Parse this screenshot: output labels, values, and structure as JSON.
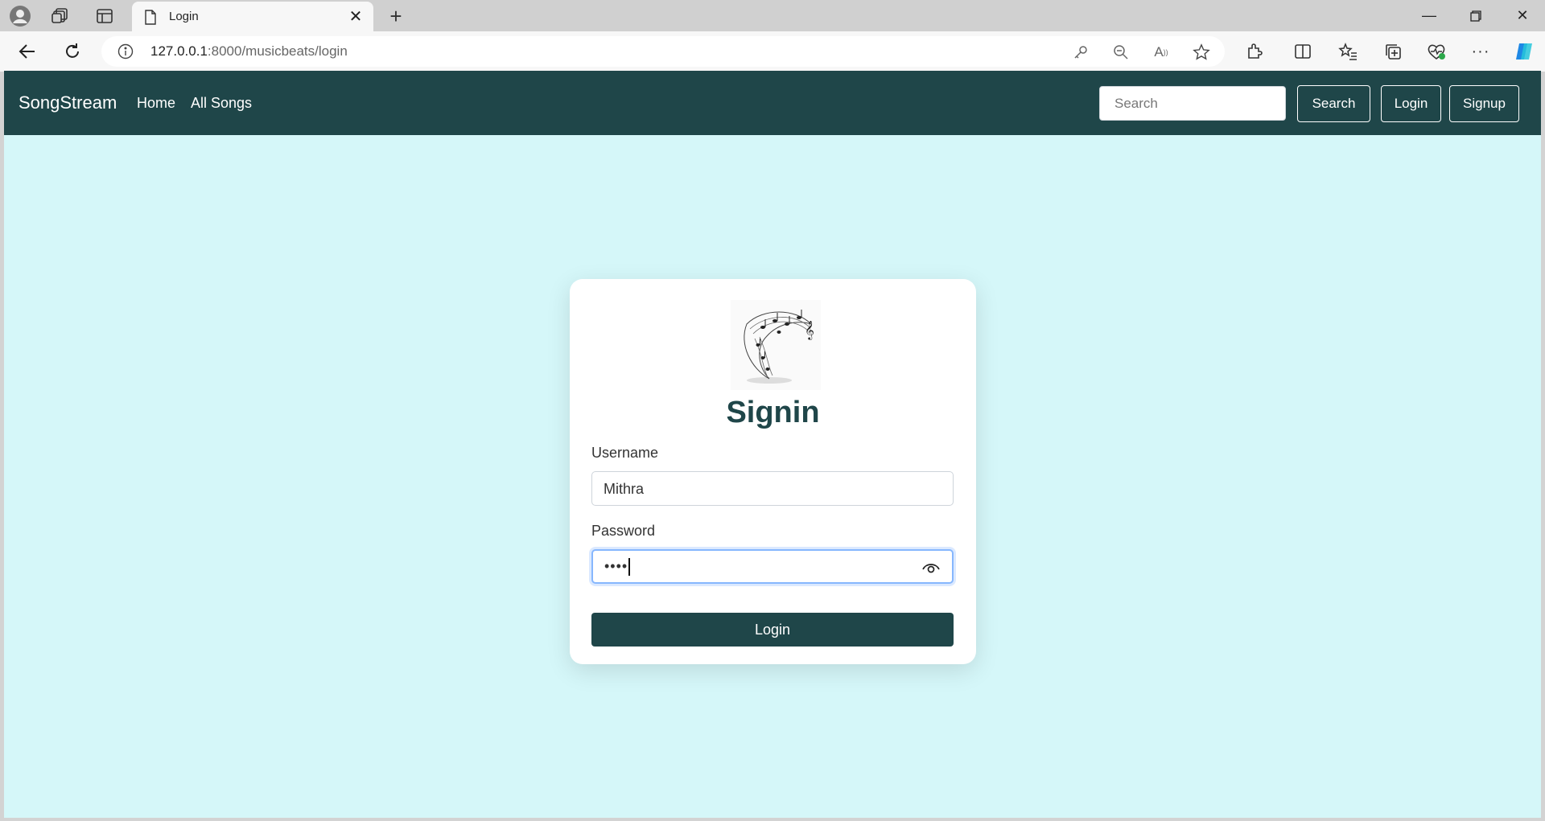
{
  "browser": {
    "tab_title": "Login",
    "url_host": "127.0.0.1",
    "url_rest": ":8000/musicbeats/login"
  },
  "navbar": {
    "brand": "SongStream",
    "links": [
      "Home",
      "All Songs"
    ],
    "search_placeholder": "Search",
    "search_button": "Search",
    "login_button": "Login",
    "signup_button": "Signup"
  },
  "signin": {
    "title": "Signin",
    "username_label": "Username",
    "username_value": "Mithra",
    "password_label": "Password",
    "password_masked": "••••",
    "submit_label": "Login"
  },
  "colors": {
    "navbar_bg": "#1f4649",
    "page_bg": "#d5f7f9",
    "card_bg": "#ffffff",
    "button_bg": "#1f4649"
  }
}
